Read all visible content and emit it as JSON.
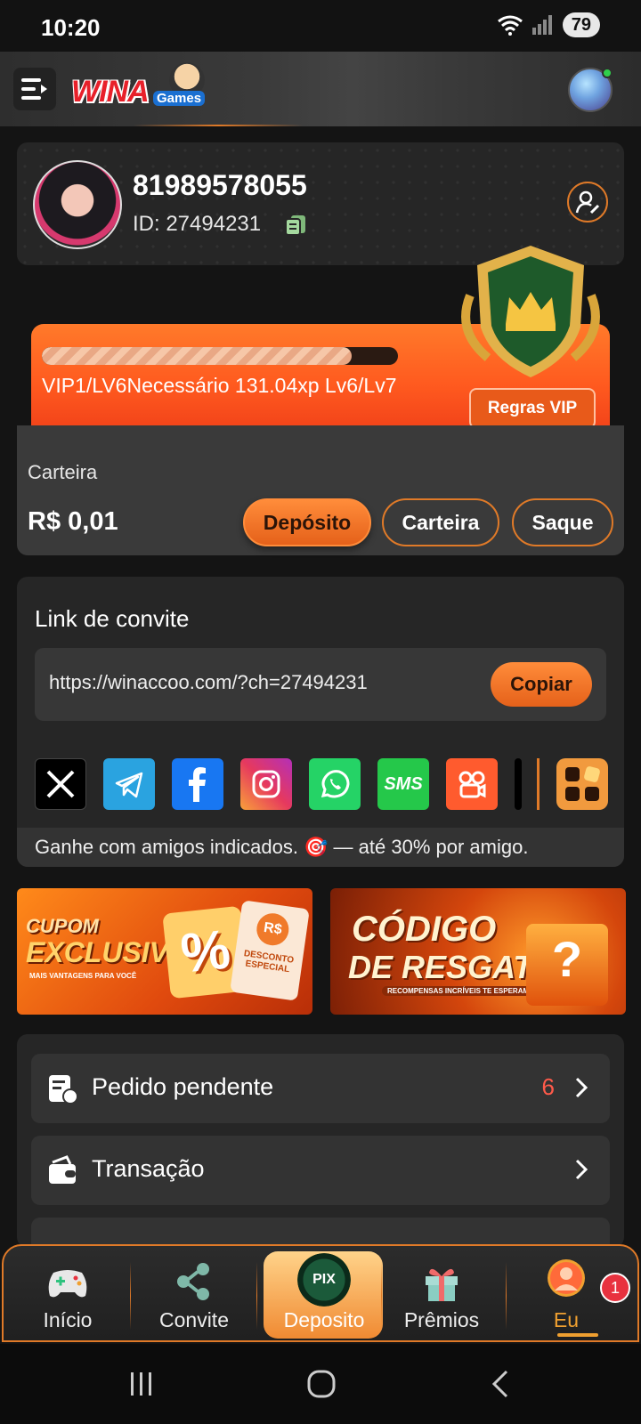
{
  "status_bar": {
    "time": "10:20",
    "battery": "79"
  },
  "header": {
    "logo_text": "WINA",
    "logo_sub": "Games"
  },
  "profile": {
    "phone": "81989578055",
    "id_label": "ID: 27494231"
  },
  "vip": {
    "progress": 0.87,
    "text": "VIP1/LV6Necessário 131.04xp Lv6/Lv7",
    "rules_label": "Regras VIP"
  },
  "wallet": {
    "label": "Carteira",
    "amount": "R$ 0,01",
    "deposit_label": "Depósito",
    "wallet_label": "Carteira",
    "withdraw_label": "Saque"
  },
  "invite": {
    "title": "Link de convite",
    "url": "https://winaccoo.com/?ch=27494231",
    "copy_label": "Copiar",
    "footer": "Ganhe com amigos indicados. 🎯 — até 30% por amigo."
  },
  "banners": {
    "coupon": {
      "line1": "CUPOM",
      "line2": "EXCLUSIVO",
      "sub": "MAIS VANTAGENS PARA VOCÊ",
      "percent": "%",
      "currency": "R$",
      "ticket_text": "DESCONTO ESPECIAL"
    },
    "redeem": {
      "line1": "CÓDIGO",
      "line2": "DE RESGATE",
      "sub": "RECOMPENSAS INCRÍVEIS TE ESPERAM!",
      "mark": "?"
    }
  },
  "menu": {
    "items": [
      {
        "label": "Pedido pendente",
        "count": "6"
      },
      {
        "label": "Transação"
      }
    ]
  },
  "social": {
    "sms_label": "SMS"
  },
  "bottom_nav": {
    "items": [
      {
        "label": "Início"
      },
      {
        "label": "Convite"
      },
      {
        "label": "Deposito",
        "pix": "PIX"
      },
      {
        "label": "Prêmios"
      },
      {
        "label": "Eu",
        "badge": "1"
      }
    ]
  },
  "colors": {
    "accent": "#e07a28",
    "background": "#141414",
    "card": "#262626"
  }
}
